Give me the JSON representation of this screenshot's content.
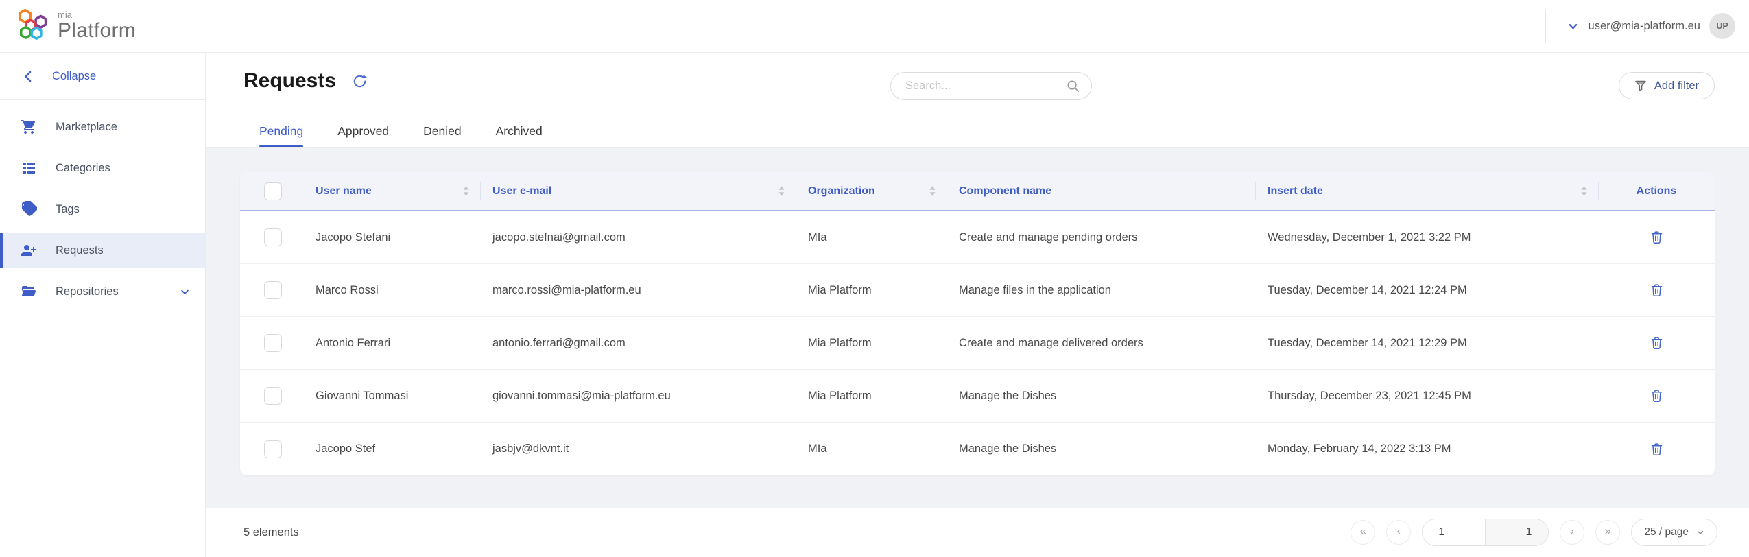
{
  "brand": {
    "name_small": "mia",
    "name_large": "Platform"
  },
  "topbar": {
    "user_email": "user@mia-platform.eu",
    "user_initials": "UP"
  },
  "sidebar": {
    "collapse_label": "Collapse",
    "items": [
      {
        "label": "Marketplace",
        "icon": "shopping-cart-icon",
        "active": false
      },
      {
        "label": "Categories",
        "icon": "list-icon",
        "active": false
      },
      {
        "label": "Tags",
        "icon": "tags-icon",
        "active": false
      },
      {
        "label": "Requests",
        "icon": "user-add-icon",
        "active": true
      },
      {
        "label": "Repositories",
        "icon": "open-folder-icon",
        "active": false,
        "expandable": true
      }
    ]
  },
  "page": {
    "title": "Requests"
  },
  "toolbar": {
    "search_placeholder": "Search...",
    "add_filter_label": "Add filter"
  },
  "tabs": [
    {
      "label": "Pending",
      "active": true
    },
    {
      "label": "Approved",
      "active": false
    },
    {
      "label": "Denied",
      "active": false
    },
    {
      "label": "Archived",
      "active": false
    }
  ],
  "table": {
    "columns": [
      {
        "label": "User name",
        "sortable": true
      },
      {
        "label": "User e-mail",
        "sortable": true
      },
      {
        "label": "Organization",
        "sortable": true
      },
      {
        "label": "Component name",
        "sortable": false
      },
      {
        "label": "Insert date",
        "sortable": true
      },
      {
        "label": "Actions",
        "sortable": false
      }
    ],
    "rows": [
      {
        "user_name": "Jacopo Stefani",
        "email": "jacopo.stefnai@gmail.com",
        "organization": "MIa",
        "component": "Create and manage pending orders",
        "insert_date": "Wednesday, December 1, 2021 3:22 PM"
      },
      {
        "user_name": "Marco Rossi",
        "email": "marco.rossi@mia-platform.eu",
        "organization": "Mia Platform",
        "component": "Manage files in the application",
        "insert_date": "Tuesday, December 14, 2021 12:24 PM"
      },
      {
        "user_name": "Antonio Ferrari",
        "email": "antonio.ferrari@gmail.com",
        "organization": "Mia Platform",
        "component": "Create and manage delivered orders",
        "insert_date": "Tuesday, December 14, 2021 12:29 PM"
      },
      {
        "user_name": "Giovanni Tommasi",
        "email": "giovanni.tommasi@mia-platform.eu",
        "organization": "Mia Platform",
        "component": "Manage the Dishes",
        "insert_date": "Thursday, December 23, 2021 12:45 PM"
      },
      {
        "user_name": "Jacopo Stef",
        "email": "jasbjv@dkvnt.it",
        "organization": "MIa",
        "component": "Manage the Dishes",
        "insert_date": "Monday, February 14, 2022 3:13 PM"
      }
    ]
  },
  "pagination": {
    "total_label": "5 elements",
    "first_icon": "«",
    "prev_icon": "‹",
    "next_icon": "›",
    "last_icon": "»",
    "current_page": "1",
    "total_pages": "1",
    "page_size_label": "25 / page"
  },
  "icons": {
    "collapse": "chevron-left",
    "marketplace": "shopping-cart",
    "categories": "list",
    "tags": "tags",
    "requests": "user-add",
    "repositories": "open-folder",
    "repositories_caret": "chevron-down",
    "refresh": "reload-circular-arrow",
    "search": "magnifier",
    "add_filter": "funnel",
    "sort": "caret-up-down",
    "row_action": "trash",
    "user_menu": "chevron-down",
    "page_size_caret": "chevron-down"
  },
  "colors": {
    "primary": "#3f5dc7",
    "page-bg": "#f1f2f5",
    "header-row-bg": "#f3f4f9",
    "header-row-border": "#a9b7e2",
    "active-item-bg": "#e9edf8",
    "add-filter-text": "#3f5796",
    "logo-orange": "#f5821f",
    "logo-red": "#e23c44",
    "logo-purple": "#7f3f98",
    "logo-green": "#36a935",
    "logo-cyan": "#32b4e6"
  }
}
